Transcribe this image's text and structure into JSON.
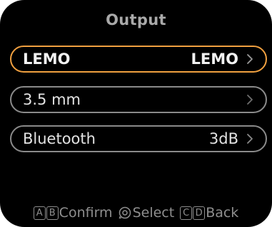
{
  "screen": {
    "title": "Output"
  },
  "menu": {
    "items": [
      {
        "label": "LEMO",
        "value": "LEMO",
        "selected": true
      },
      {
        "label": "3.5 mm",
        "value": "",
        "selected": false
      },
      {
        "label": "Bluetooth",
        "value": "3dB",
        "selected": false
      }
    ]
  },
  "footer": {
    "confirm": {
      "keys": [
        "A",
        "B"
      ],
      "label": "Confirm"
    },
    "select": {
      "icon": "dial-icon",
      "label": "Select"
    },
    "back": {
      "keys": [
        "C",
        "D"
      ],
      "label": "Back"
    }
  },
  "colors": {
    "background": "#000000",
    "accent": "#f0a040",
    "outline": "#8a8a8a",
    "title": "#a9a9a9"
  }
}
